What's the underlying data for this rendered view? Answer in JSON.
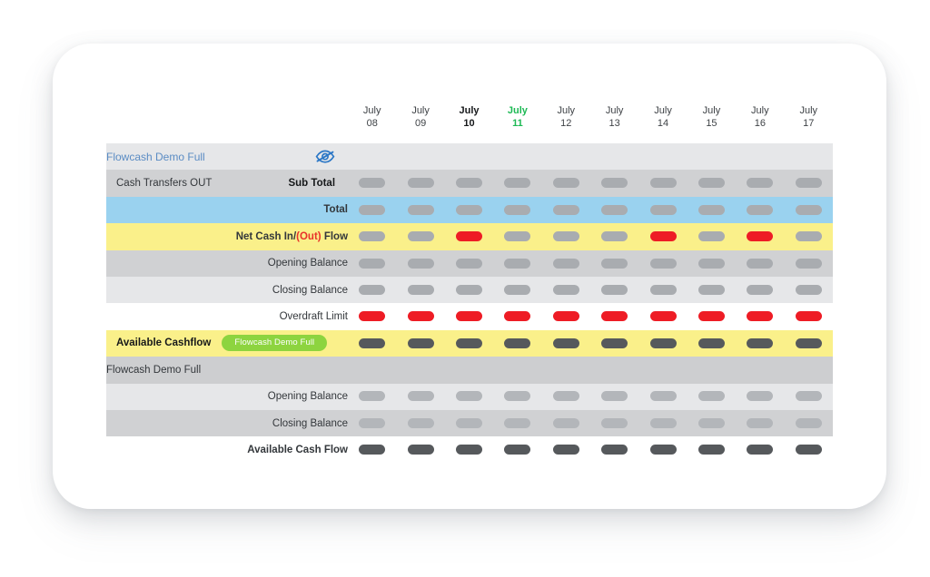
{
  "toolbar": {
    "filter_label": "Cash Transfers OUT",
    "collapse_icon": "chevron-up-icon",
    "accent_blue": "#2b77c6"
  },
  "header": {
    "days": [
      {
        "month": "July",
        "day": "08",
        "state": "normal"
      },
      {
        "month": "July",
        "day": "09",
        "state": "normal"
      },
      {
        "month": "July",
        "day": "10",
        "state": "today"
      },
      {
        "month": "July",
        "day": "11",
        "state": "next"
      },
      {
        "month": "July",
        "day": "12",
        "state": "normal"
      },
      {
        "month": "July",
        "day": "13",
        "state": "normal"
      },
      {
        "month": "July",
        "day": "14",
        "state": "normal"
      },
      {
        "month": "July",
        "day": "15",
        "state": "normal"
      },
      {
        "month": "July",
        "day": "16",
        "state": "normal"
      },
      {
        "month": "July",
        "day": "17",
        "state": "normal"
      }
    ]
  },
  "rows": {
    "account_header": {
      "label": "Flowcash Demo Full",
      "eye_icon": "eye-off-icon"
    },
    "subtotal": {
      "left_label": "Cash Transfers OUT",
      "right_label": "Sub Total"
    },
    "total": {
      "label": "Total"
    },
    "net_cash": {
      "prefix": "Net Cash In/",
      "paren": "(Out)",
      "suffix": " Flow"
    },
    "opening_balance_1": {
      "label": "Opening Balance"
    },
    "closing_balance_1": {
      "label": "Closing Balance"
    },
    "overdraft_limit": {
      "label": "Overdraft Limit"
    },
    "available_cashflow": {
      "label": "Available Cashflow",
      "badge": "Flowcash Demo Full"
    },
    "group_header": {
      "label": "Flowcash Demo Full"
    },
    "opening_balance_2": {
      "label": "Opening Balance"
    },
    "closing_balance_2": {
      "label": "Closing Balance"
    },
    "available_cash_flow": {
      "label": "Available Cash Flow"
    }
  },
  "cells": {
    "subtotal": [
      "gray",
      "gray",
      "gray",
      "gray",
      "gray",
      "gray",
      "gray",
      "gray",
      "gray",
      "gray"
    ],
    "total": [
      "gray",
      "gray",
      "gray",
      "gray",
      "gray",
      "gray",
      "gray",
      "gray",
      "gray",
      "gray"
    ],
    "net_cash": [
      "gray",
      "gray",
      "red",
      "gray",
      "gray",
      "gray",
      "red",
      "gray",
      "red",
      "gray"
    ],
    "opening_balance_1": [
      "gray",
      "gray",
      "gray",
      "gray",
      "gray",
      "gray",
      "gray",
      "gray",
      "gray",
      "gray"
    ],
    "closing_balance_1": [
      "gray",
      "gray",
      "gray",
      "gray",
      "gray",
      "gray",
      "gray",
      "gray",
      "gray",
      "gray"
    ],
    "overdraft_limit": [
      "red",
      "red",
      "red",
      "red",
      "red",
      "red",
      "red",
      "red",
      "red",
      "red"
    ],
    "available_cashflow": [
      "dark",
      "dark",
      "dark",
      "dark",
      "dark",
      "dark",
      "dark",
      "dark",
      "dark",
      "dark"
    ],
    "opening_balance_2": [
      "lite",
      "lite",
      "lite",
      "lite",
      "lite",
      "lite",
      "lite",
      "lite",
      "lite",
      "lite"
    ],
    "closing_balance_2": [
      "lite",
      "lite",
      "lite",
      "lite",
      "lite",
      "lite",
      "lite",
      "lite",
      "lite",
      "lite"
    ],
    "available_cash_flow": [
      "dark",
      "dark",
      "dark",
      "dark",
      "dark",
      "dark",
      "dark",
      "dark",
      "dark",
      "dark"
    ]
  },
  "colors": {
    "row_gray": "#d0d1d3",
    "row_light": "#e6e7e9",
    "row_blue": "#9ad2ef",
    "row_yellow": "#faf08a",
    "pill_gray": "#a9acb0",
    "pill_red": "#ee1c25",
    "pill_dark": "#56595c",
    "badge_green": "#8dd43f",
    "today_green": "#1db954",
    "link_blue": "#5b8cc4"
  }
}
